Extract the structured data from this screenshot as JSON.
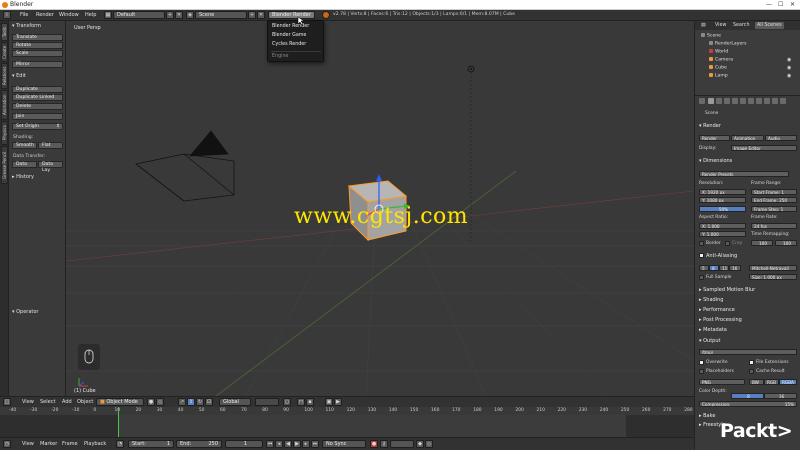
{
  "window": {
    "title": "Blender"
  },
  "info_header": {
    "menus": [
      "File",
      "Render",
      "Window",
      "Help"
    ],
    "layout": "Default",
    "scene": "Scene",
    "engine": "Blender Render",
    "stats": "v2.78 | Verts:8 | Faces:6 | Tris:12 | Objects:1/3 | Lamps:0/1 | Mem:8.07M | Cube"
  },
  "engine_menu": {
    "items": [
      "Blender Render",
      "Blender Game",
      "Cycles Render"
    ],
    "footer": "Engine"
  },
  "tool_tabs": [
    "Tools",
    "Create",
    "Relations",
    "Animation",
    "Physics",
    "Grease Pencil"
  ],
  "tool_shelf": {
    "transform_header": "Transform",
    "transform_buttons": [
      "Translate",
      "Rotate",
      "Scale",
      "Mirror"
    ],
    "edit_header": "Edit",
    "edit_buttons": [
      "Duplicate",
      "Duplicate Linked",
      "Delete",
      "Join"
    ],
    "set_origin": "Set Origin",
    "shading_label": "Shading:",
    "shading_buttons": [
      "Smooth",
      "Flat"
    ],
    "data_transfer_label": "Data Transfer:",
    "data_transfer_buttons": [
      "Data",
      "Data Lay"
    ],
    "history_header": "History",
    "operator_header": "Operator"
  },
  "viewport": {
    "view_label": "User Persp",
    "object_label": "(1) Cube",
    "watermark": "www.cgtsj.com"
  },
  "outliner": {
    "tabs": [
      "View",
      "Search",
      "All Scenes"
    ],
    "rows": [
      {
        "label": "Scene",
        "color": "#8a8a8a"
      },
      {
        "label": "RenderLayers",
        "color": "#8a8a8a"
      },
      {
        "label": "World",
        "color": "#c04040"
      },
      {
        "label": "Camera",
        "color": "#e89a3c"
      },
      {
        "label": "Cube",
        "color": "#e89a3c"
      },
      {
        "label": "Lamp",
        "color": "#e89a3c"
      }
    ]
  },
  "properties": {
    "scene_name": "Scene",
    "render_header": "Render",
    "render_buttons": [
      "Render",
      "Animation",
      "Audio"
    ],
    "display_label": "Display:",
    "display_value": "Image Editor",
    "dimensions_header": "Dimensions",
    "render_presets": "Render Presets",
    "resolution_label": "Resolution:",
    "res_x": "X:    1920 px",
    "res_y": "Y:    1080 px",
    "res_pct": "50%",
    "frame_range_label": "Frame Range:",
    "start_frame": "Start Frame:   1",
    "end_frame": "End Frame:  250",
    "frame_step": "Frame Step:   1",
    "aspect_label": "Aspect Ratio:",
    "asp_x": "X:      1.000",
    "asp_y": "Y:      1.000",
    "frame_rate_label": "Frame Rate:",
    "fps": "24 fps",
    "time_remap_label": "Time Remapping:",
    "remap_old": "100",
    "remap_new": "100",
    "border": "Border",
    "crop": "Crop",
    "aa_header": "Anti-Aliasing",
    "aa_samples": [
      "5",
      "8",
      "11",
      "16"
    ],
    "aa_filter": "Mitchell-Netravali",
    "full_sample": "Full Sample",
    "aa_size": "Size:   1.000 px",
    "motion_blur": "Sampled Motion Blur",
    "shading": "Shading",
    "performance": "Performance",
    "post_processing": "Post Processing",
    "metadata": "Metadata",
    "output_header": "Output",
    "output_path": "/tmp\\",
    "overwrite": "Overwrite",
    "file_ext": "File Extensions",
    "placeholders": "Placeholders",
    "cache_result": "Cache Result",
    "format": "PNG",
    "color_modes": [
      "BW",
      "RGB",
      "RGBA"
    ],
    "color_depth_label": "Color Depth:",
    "color_depths": [
      "8",
      "16"
    ],
    "compression": "Compression:",
    "compression_value": "15%",
    "bake": "Bake",
    "freestyle": "Freestyle"
  },
  "view3d_header": {
    "items": [
      "View",
      "Select",
      "Add",
      "Object"
    ],
    "mode": "Object Mode",
    "orientation": "Global"
  },
  "timeline": {
    "ticks": [
      "-40",
      "-30",
      "-20",
      "-10",
      "0",
      "10",
      "20",
      "30",
      "40",
      "50",
      "60",
      "70",
      "80",
      "90",
      "100",
      "110",
      "120",
      "130",
      "140",
      "150",
      "160",
      "170",
      "180",
      "190",
      "200",
      "210",
      "220",
      "230",
      "240",
      "250",
      "260",
      "270",
      "280"
    ],
    "menus": [
      "View",
      "Marker",
      "Frame",
      "Playback"
    ],
    "start": "Start:",
    "start_value": "1",
    "end": "End:",
    "end_value": "250",
    "current": "1",
    "sync": "No Sync"
  },
  "brand": {
    "logo_text": "Packt>"
  }
}
